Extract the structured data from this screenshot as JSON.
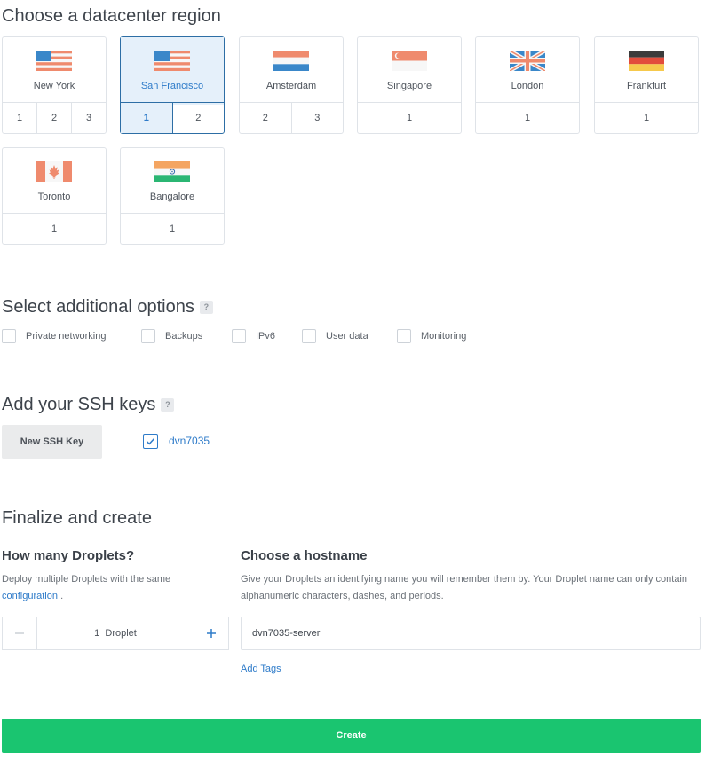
{
  "datacenter": {
    "title": "Choose a datacenter region",
    "regions": [
      {
        "name": "New York",
        "flag": "usa-flag-icon",
        "dcs": [
          "1",
          "2",
          "3"
        ],
        "selected": false
      },
      {
        "name": "San Francisco",
        "flag": "usa-flag-icon",
        "dcs": [
          "1",
          "2"
        ],
        "selected": true
      },
      {
        "name": "Amsterdam",
        "flag": "netherlands-flag-icon",
        "dcs": [
          "2",
          "3"
        ],
        "selected": false
      },
      {
        "name": "Singapore",
        "flag": "singapore-flag-icon",
        "dcs": [
          "1"
        ],
        "selected": false
      },
      {
        "name": "London",
        "flag": "uk-flag-icon",
        "dcs": [
          "1"
        ],
        "selected": false
      },
      {
        "name": "Frankfurt",
        "flag": "germany-flag-icon",
        "dcs": [
          "1"
        ],
        "selected": false
      },
      {
        "name": "Toronto",
        "flag": "canada-flag-icon",
        "dcs": [
          "1"
        ],
        "selected": false
      },
      {
        "name": "Bangalore",
        "flag": "india-flag-icon",
        "dcs": [
          "1"
        ],
        "selected": false
      }
    ]
  },
  "options": {
    "title": "Select additional options",
    "help": "?",
    "items": [
      {
        "label": "Private networking",
        "checked": false
      },
      {
        "label": "Backups",
        "checked": false
      },
      {
        "label": "IPv6",
        "checked": false
      },
      {
        "label": "User data",
        "checked": false
      },
      {
        "label": "Monitoring",
        "checked": false
      }
    ]
  },
  "ssh": {
    "title": "Add your SSH keys",
    "help": "?",
    "new_key_label": "New SSH Key",
    "key_name": "dvn7035",
    "key_checked": true
  },
  "finalize": {
    "title": "Finalize and create",
    "droplets": {
      "heading": "How many Droplets?",
      "desc": "Deploy multiple Droplets with the same",
      "link": "configuration",
      "desc_end": ".",
      "count_label": "1  Droplet"
    },
    "hostname": {
      "heading": "Choose a hostname",
      "desc": "Give your Droplets an identifying name you will remember them by. Your Droplet name can only contain alphanumeric characters, dashes, and periods.",
      "value": "dvn7035-server",
      "add_tags": "Add Tags"
    },
    "create_label": "Create"
  },
  "colors": {
    "accent": "#2e7bc9",
    "selected_bg": "#e5f0fa",
    "create_green": "#1ac570"
  }
}
